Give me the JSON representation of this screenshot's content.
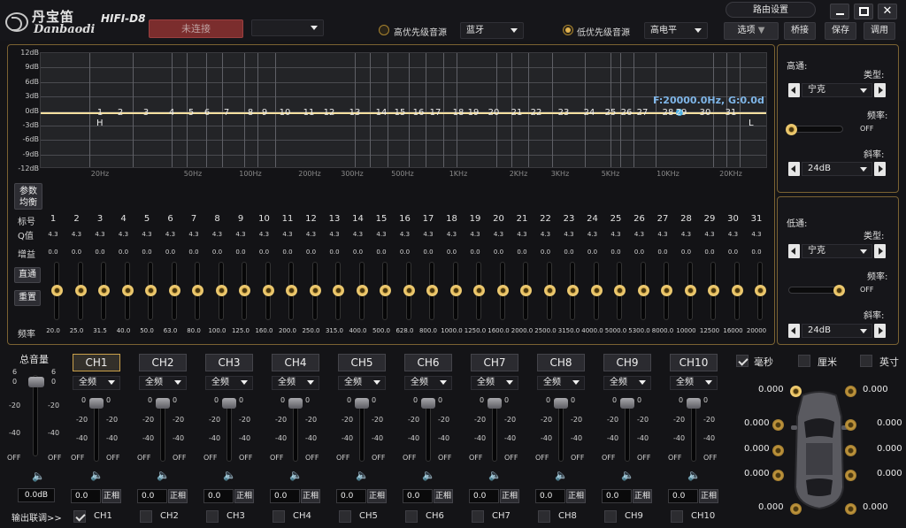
{
  "title": {
    "brand_cn": "丹宝笛",
    "brand_en": "Danbaodi",
    "model": "HIFI-D8",
    "connect": "未连接",
    "route": "路由设置"
  },
  "sources": {
    "high_label": "高优先级音源",
    "high_value": "蓝牙",
    "low_label": "低优先级音源",
    "low_value": "高电平"
  },
  "toolbar": {
    "options": "选项",
    "bridge": "桥接",
    "save": "保存",
    "call": "调用"
  },
  "graph": {
    "db_labels": [
      "12dB",
      "9dB",
      "6dB",
      "3dB",
      "0dB",
      "-3dB",
      "-6dB",
      "-9dB",
      "-12dB"
    ],
    "freq_labels": [
      "20Hz",
      "50Hz",
      "100Hz",
      "200Hz",
      "300Hz",
      "500Hz",
      "1KHz",
      "2KHz",
      "3KHz",
      "5KHz",
      "10KHz",
      "20KHz"
    ],
    "readout": "F:20000.0Hz, G:0.0d",
    "hp_marker": "H",
    "lp_marker": "L"
  },
  "eq": {
    "param_btn": "参数\n均衡",
    "direct_btn": "直通",
    "reset_btn": "重置",
    "row_band": "标号",
    "row_q": "Q值",
    "row_gain": "增益",
    "row_freq": "频率",
    "bands": [
      1,
      2,
      3,
      4,
      5,
      6,
      7,
      8,
      9,
      10,
      11,
      12,
      13,
      14,
      15,
      16,
      17,
      18,
      19,
      20,
      21,
      22,
      23,
      24,
      25,
      26,
      27,
      28,
      29,
      30,
      31
    ],
    "q": "4.3",
    "gain": "0.0",
    "freqs": [
      "20.0",
      "25.0",
      "31.5",
      "40.0",
      "50.0",
      "63.0",
      "80.0",
      "100.0",
      "125.0",
      "160.0",
      "200.0",
      "250.0",
      "315.0",
      "400.0",
      "500.0",
      "628.0",
      "800.0",
      "1000.0",
      "1250.0",
      "1600.0",
      "2000.0",
      "2500.0",
      "3150.0",
      "4000.0",
      "5000.0",
      "5300.0",
      "8000.0",
      "10000",
      "12500",
      "16000",
      "20000"
    ]
  },
  "highpass": {
    "title": "高通:",
    "type_label": "类型:",
    "type": "宁克",
    "freq_label": "频率:",
    "freq": "OFF",
    "slope_label": "斜率:",
    "slope": "24dB"
  },
  "lowpass": {
    "title": "低通:",
    "type_label": "类型:",
    "type": "宁克",
    "freq_label": "频率:",
    "freq": "OFF",
    "slope_label": "斜率:",
    "slope": "24dB"
  },
  "master": {
    "label": "总音量",
    "scale": [
      "6",
      "0",
      "-20",
      "-40",
      "OFF"
    ],
    "value": "0.0dB",
    "link": "输出联调>>"
  },
  "channels": [
    {
      "name": "CH1",
      "mode": "全频",
      "value": "0.0",
      "phase": "正相",
      "checked": true
    },
    {
      "name": "CH2",
      "mode": "全频",
      "value": "0.0",
      "phase": "正相",
      "checked": false
    },
    {
      "name": "CH3",
      "mode": "全频",
      "value": "0.0",
      "phase": "正相",
      "checked": false
    },
    {
      "name": "CH4",
      "mode": "全频",
      "value": "0.0",
      "phase": "正相",
      "checked": false
    },
    {
      "name": "CH5",
      "mode": "全频",
      "value": "0.0",
      "phase": "正相",
      "checked": false
    },
    {
      "name": "CH6",
      "mode": "全频",
      "value": "0.0",
      "phase": "正相",
      "checked": false
    },
    {
      "name": "CH7",
      "mode": "全频",
      "value": "0.0",
      "phase": "正相",
      "checked": false
    },
    {
      "name": "CH8",
      "mode": "全频",
      "value": "0.0",
      "phase": "正相",
      "checked": false
    },
    {
      "name": "CH9",
      "mode": "全频",
      "value": "0.0",
      "phase": "正相",
      "checked": false
    },
    {
      "name": "CH10",
      "mode": "全频",
      "value": "0.0",
      "phase": "正相",
      "checked": false
    }
  ],
  "ch_scale": [
    "0",
    "-20",
    "-40",
    "OFF"
  ],
  "units": {
    "ms": "毫秒",
    "cm": "厘米",
    "inch": "英寸",
    "ms_checked": true,
    "cm_checked": false,
    "inch_checked": false
  },
  "delays": [
    "0.000",
    "0.000",
    "0.000",
    "0.000",
    "0.000",
    "0.000",
    "0.000",
    "0.000",
    "0.000",
    "0.000"
  ],
  "colors": {
    "accent": "#c9a04a",
    "eq_line": "#f5e0a0",
    "readout": "#7fb6e8"
  }
}
